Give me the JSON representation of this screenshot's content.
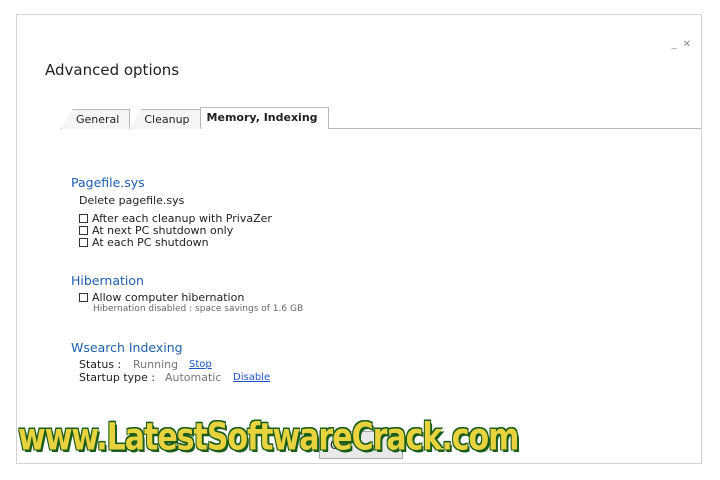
{
  "window": {
    "title": "Advanced options",
    "minimize_glyph": "_",
    "close_glyph": "✕"
  },
  "tabs": [
    {
      "label": "General",
      "active": false
    },
    {
      "label": "Cleanup",
      "active": false
    },
    {
      "label": "Memory, Indexing",
      "active": true
    }
  ],
  "pagefile": {
    "title": "Pagefile.sys",
    "subtitle": "Delete pagefile.sys",
    "options": [
      {
        "label": "After each cleanup with PrivaZer",
        "checked": false
      },
      {
        "label": "At next PC shutdown only",
        "checked": false
      },
      {
        "label": "At each PC shutdown",
        "checked": false
      }
    ]
  },
  "hibernation": {
    "title": "Hibernation",
    "option_label": "Allow computer hibernation",
    "checked": false,
    "note": "Hibernation disabled : space savings of 1.6 GB"
  },
  "wsearch": {
    "title": "Wsearch Indexing",
    "status_label": "Status :",
    "status_value": "Running",
    "status_action": "Stop",
    "startup_label": "Startup type :",
    "startup_value": "Automatic",
    "startup_action": "Disable"
  },
  "footer": {
    "ok_label": "Ok"
  },
  "watermark": {
    "text": "www.LatestSoftwareCrack.com"
  },
  "colors": {
    "section_title": "#1f5fb0",
    "link": "#1c54c7",
    "watermark_fill": "#e8d33f",
    "watermark_outline": "#1a5c1a"
  }
}
